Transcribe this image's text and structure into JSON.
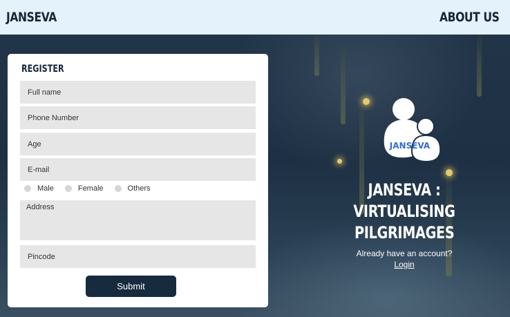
{
  "header": {
    "brand": "JANSEVA",
    "about_label": "ABOUT US"
  },
  "register": {
    "title": "REGISTER",
    "fields": {
      "full_name": {
        "placeholder": "Full name"
      },
      "phone": {
        "placeholder": "Phone Number"
      },
      "age": {
        "placeholder": "Age"
      },
      "email": {
        "placeholder": "E-mail"
      },
      "address": {
        "placeholder": "Address"
      },
      "pincode": {
        "placeholder": "Pincode"
      }
    },
    "gender_options": [
      "Male",
      "Female",
      "Others"
    ],
    "submit_label": "Submit"
  },
  "hero": {
    "logo_text": "JANSEVA",
    "tagline_line1": "JANSEVA : VIRTUALISING",
    "tagline_line2": "PILGRIMAGES",
    "account_prompt": "Already have an account?",
    "login_label": "Login"
  },
  "colors": {
    "navy": "#172b3e",
    "header_bg": "#e3f2fb",
    "field_bg": "#e6e6e6"
  }
}
